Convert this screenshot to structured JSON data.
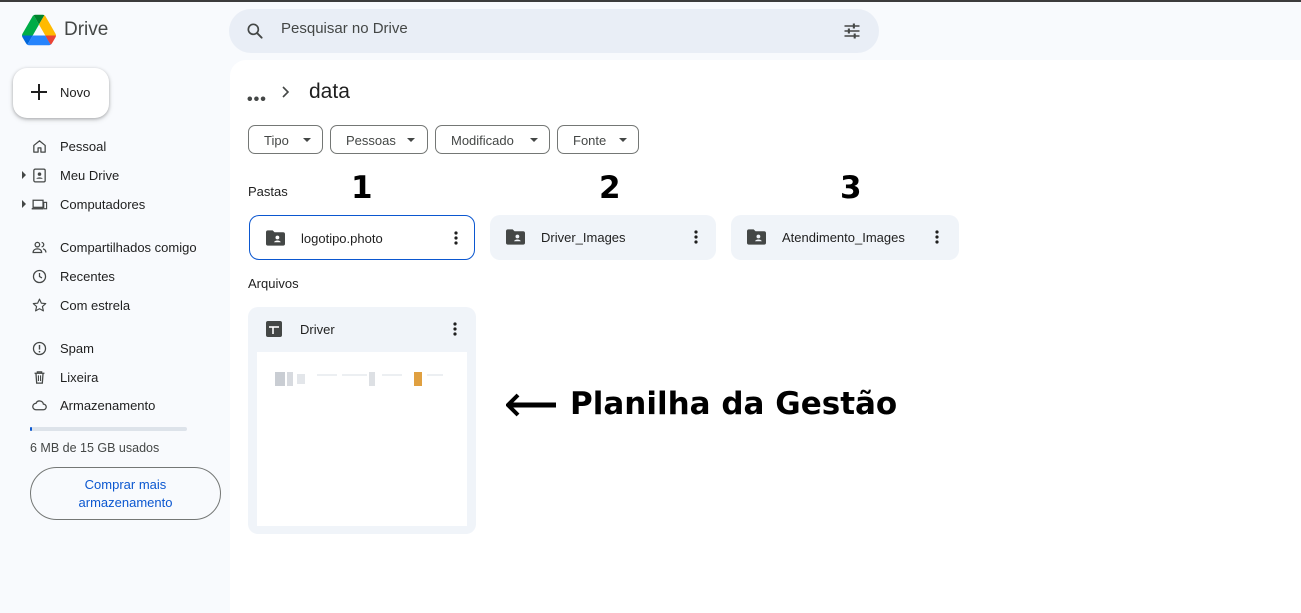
{
  "app": {
    "name": "Drive"
  },
  "search": {
    "placeholder": "Pesquisar no Drive"
  },
  "sidebar": {
    "new_label": "Novo",
    "items": [
      {
        "label": "Pessoal",
        "icon": "home-icon"
      },
      {
        "label": "Meu Drive",
        "icon": "my-drive-icon"
      },
      {
        "label": "Computadores",
        "icon": "computers-icon"
      },
      {
        "label": "Compartilhados comigo",
        "icon": "shared-icon"
      },
      {
        "label": "Recentes",
        "icon": "clock-icon"
      },
      {
        "label": "Com estrela",
        "icon": "star-icon"
      },
      {
        "label": "Spam",
        "icon": "spam-icon"
      },
      {
        "label": "Lixeira",
        "icon": "trash-icon"
      },
      {
        "label": "Armazenamento",
        "icon": "cloud-icon"
      }
    ],
    "storage": {
      "text": "6 MB de 15 GB usados",
      "used_fraction": 0.0004
    },
    "buy_label_line1": "Comprar mais",
    "buy_label_line2": "armazenamento"
  },
  "breadcrumb": {
    "more": "•••",
    "current": "data"
  },
  "filters": [
    {
      "label": "Tipo"
    },
    {
      "label": "Pessoas"
    },
    {
      "label": "Modificado"
    },
    {
      "label": "Fonte"
    }
  ],
  "sections": {
    "folders": "Pastas",
    "files": "Arquivos"
  },
  "folders": [
    {
      "name": "logotipo.photo",
      "annotation": "1",
      "selected": true
    },
    {
      "name": "Driver_Images",
      "annotation": "2",
      "selected": false
    },
    {
      "name": "Atendimento_Images",
      "annotation": "3",
      "selected": false
    }
  ],
  "files": [
    {
      "name": "Driver",
      "type": "spreadsheet"
    }
  ],
  "annotation": {
    "text": "Planilha da Gestão"
  },
  "colors": {
    "accent": "#0b57d0",
    "background": "#f8fafd",
    "card": "#f0f4f9",
    "search": "#e9eef6"
  }
}
